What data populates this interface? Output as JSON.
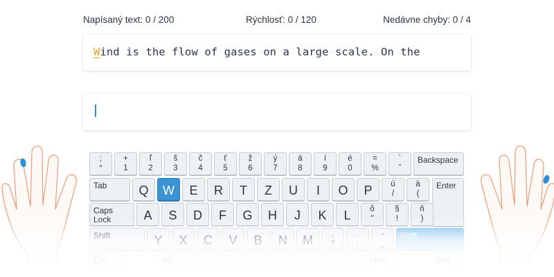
{
  "stats": {
    "typed_text": "Napísaný text: 0 / 200",
    "speed": "Rýchlosť: 0 / 120",
    "recent_errors": "Nedávne chyby: 0 / 4"
  },
  "lesson": {
    "current_char": "W",
    "remaining_text": "ind is the flow of gases on a large scale. On the"
  },
  "input": {
    "value": ""
  },
  "colors": {
    "accent": "#3a94d4",
    "current_char": "#f0a020",
    "finger": "#2a8fd6"
  },
  "keyboard": {
    "active_key": "W",
    "active_shift": "right",
    "row1": [
      {
        "top": ";",
        "bot": "°"
      },
      {
        "top": "+",
        "bot": "1"
      },
      {
        "top": "ľ",
        "bot": "2"
      },
      {
        "top": "š",
        "bot": "3"
      },
      {
        "top": "č",
        "bot": "4"
      },
      {
        "top": "ť",
        "bot": "5"
      },
      {
        "top": "ž",
        "bot": "6"
      },
      {
        "top": "ý",
        "bot": "7"
      },
      {
        "top": "á",
        "bot": "8"
      },
      {
        "top": "í",
        "bot": "9"
      },
      {
        "top": "é",
        "bot": "0"
      },
      {
        "top": "=",
        "bot": "%"
      },
      {
        "top": "´",
        "bot": "ˇ"
      }
    ],
    "backspace": "Backspace",
    "tab": "Tab",
    "row2": [
      "Q",
      "W",
      "E",
      "R",
      "T",
      "Z",
      "U",
      "I",
      "O",
      "P"
    ],
    "row2_extra": [
      {
        "top": "ú",
        "bot": "/"
      },
      {
        "top": "ä",
        "bot": "("
      }
    ],
    "enter": "Enter",
    "caps": "Caps\nLock",
    "row3": [
      "A",
      "S",
      "D",
      "F",
      "G",
      "H",
      "J",
      "K",
      "L"
    ],
    "row3_extra": [
      {
        "top": "ô",
        "bot": "\""
      },
      {
        "top": "§",
        "bot": "!"
      },
      {
        "top": "ň",
        "bot": ")"
      }
    ],
    "shift_left": "Shift",
    "row4": [
      "Y",
      "X",
      "C",
      "V",
      "B",
      "N",
      "M"
    ],
    "row4_extra": [
      {
        "top": ",",
        "bot": "?"
      },
      {
        "top": ".",
        "bot": ":"
      },
      {
        "top": "-",
        "bot": "_"
      }
    ],
    "shift_right": "Shift",
    "row5": [
      "Ctrl",
      "Alt",
      "AltGr",
      "Ctrl"
    ]
  }
}
